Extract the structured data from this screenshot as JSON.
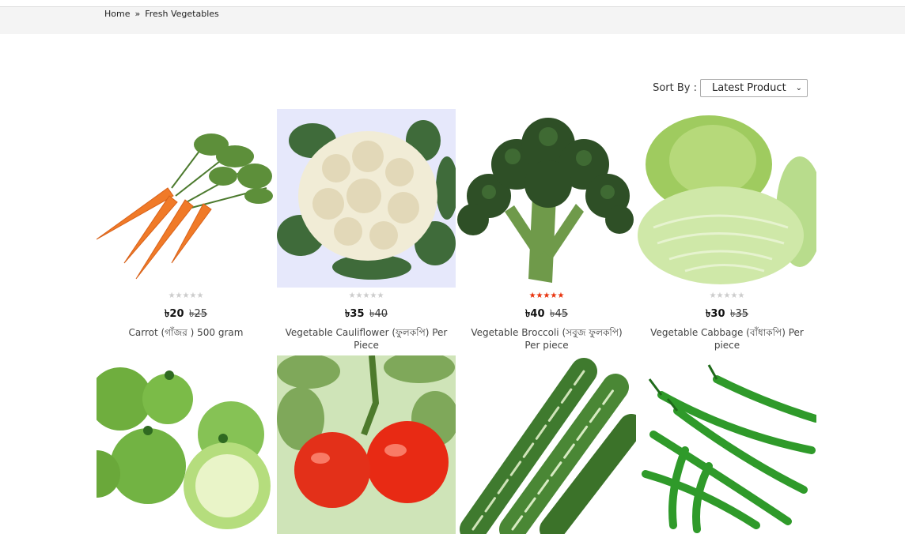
{
  "breadcrumb": {
    "items": [
      "Home",
      "Fresh Vegetables"
    ],
    "separator": "»"
  },
  "sort": {
    "label": "Sort By :",
    "selected": "Latest Product"
  },
  "products": [
    {
      "name": "Carrot (গাঁজর ) 500 gram",
      "price": "৳20",
      "old_price": "৳25",
      "rating": 0,
      "image": "carrot"
    },
    {
      "name": "Vegetable Cauliflower (ফুলকপি) Per Piece",
      "price": "৳35",
      "old_price": "৳40",
      "rating": 0,
      "image": "cauliflower"
    },
    {
      "name": "Vegetable Broccoli (সবুজ ফুলকপি) Per piece",
      "price": "৳40",
      "old_price": "৳45",
      "rating": 5,
      "image": "broccoli"
    },
    {
      "name": "Vegetable Cabbage (বাঁধাকপি) Per piece",
      "price": "৳30",
      "old_price": "৳35",
      "rating": 0,
      "image": "cabbage"
    },
    {
      "name": "",
      "price": "",
      "old_price": "",
      "rating": null,
      "image": "green-tomato"
    },
    {
      "name": "",
      "price": "",
      "old_price": "",
      "rating": null,
      "image": "red-tomato"
    },
    {
      "name": "",
      "price": "",
      "old_price": "",
      "rating": null,
      "image": "snake-gourd"
    },
    {
      "name": "",
      "price": "",
      "old_price": "",
      "rating": null,
      "image": "green-chili"
    }
  ],
  "colors": {
    "rated_star": "#e8320c",
    "unrated_star": "#cccccc",
    "breadcrumb_bg": "#f4f4f4"
  }
}
